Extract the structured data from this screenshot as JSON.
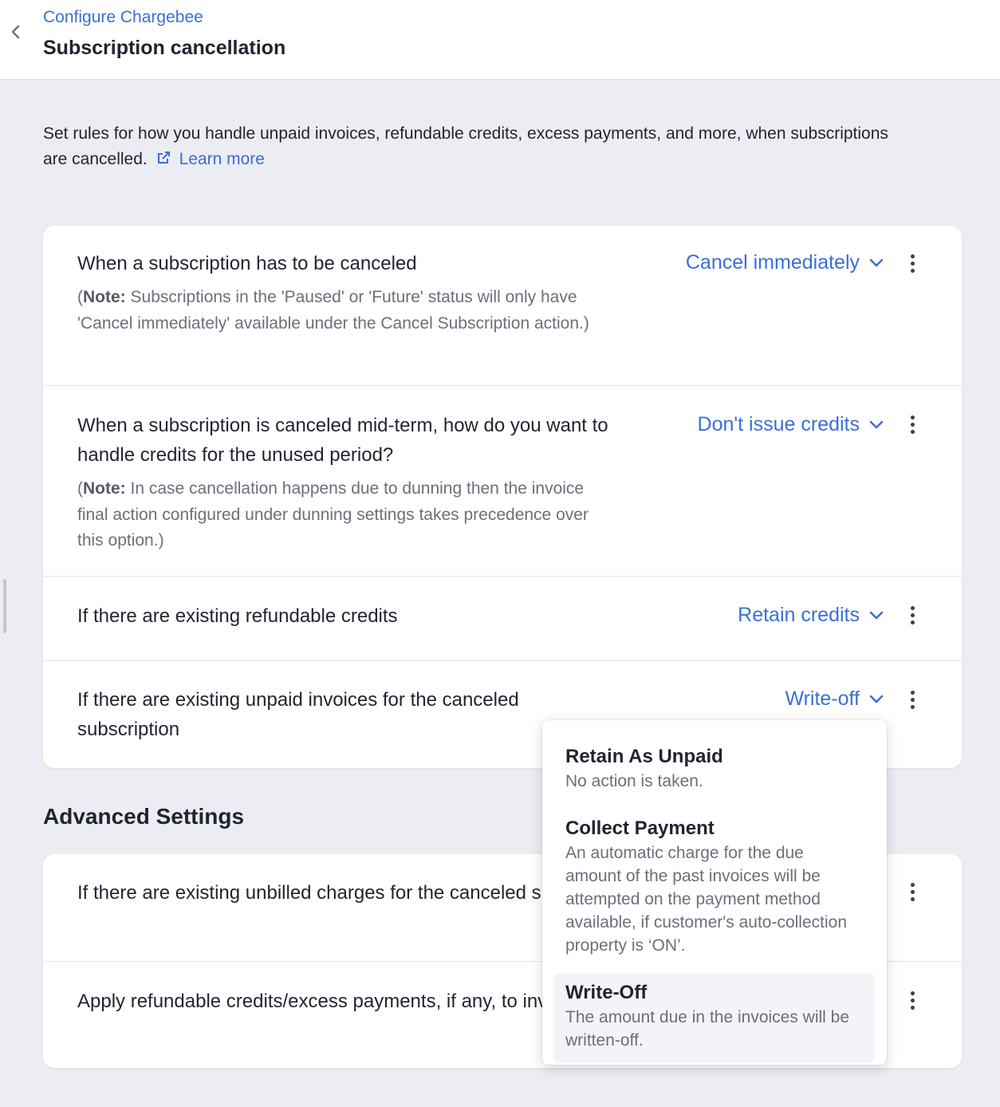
{
  "header": {
    "breadcrumb": "Configure Chargebee",
    "title": "Subscription cancellation"
  },
  "intro": {
    "text": "Set rules for how you handle unpaid invoices, refundable credits, excess payments, and more, when subscriptions are cancelled.",
    "learn_more": "Learn more"
  },
  "rules": [
    {
      "question": "When a subscription has to be canceled",
      "note_prefix": "(",
      "note_label": "Note:",
      "note_text": " Subscriptions in the 'Paused' or 'Future' status will only have 'Cancel immediately' available under the Cancel Subscription action.)",
      "value": "Cancel immediately"
    },
    {
      "question": "When a subscription is canceled mid-term, how do you want to handle credits for the unused period?",
      "note_prefix": "(",
      "note_label": "Note:",
      "note_text": " In case cancellation happens due to dunning then the invoice final action configured under dunning settings takes precedence over this option.)",
      "value": "Don't issue credits"
    },
    {
      "question": "If there are existing refundable credits",
      "value": "Retain credits"
    },
    {
      "question": "If there are existing unpaid invoices for the canceled subscription",
      "value": "Write-off"
    }
  ],
  "advanced": {
    "title": "Advanced Settings",
    "rules": [
      {
        "question": "If there are existing unbilled charges for the canceled subscription"
      },
      {
        "question": "Apply refundable credits/excess payments, if any, to invoices"
      }
    ]
  },
  "dropdown_menu": {
    "options": [
      {
        "title": "Retain As Unpaid",
        "description": "No action is taken."
      },
      {
        "title": "Collect Payment",
        "description": "An automatic charge for the due amount of the past invoices will be attempted on the payment method available, if customer's auto-collection property is ‘ON’."
      },
      {
        "title": "Write-Off",
        "description": "The amount due in the invoices will be written-off."
      }
    ],
    "selected": "Write-Off"
  },
  "colors": {
    "accent": "#3b6fd6",
    "background": "#ececf3",
    "card": "#ffffff",
    "muted_text": "#6b6f7b"
  },
  "icons": [
    "chevron-left-icon",
    "external-link-icon",
    "chevron-down-icon",
    "kebab-menu-icon"
  ]
}
